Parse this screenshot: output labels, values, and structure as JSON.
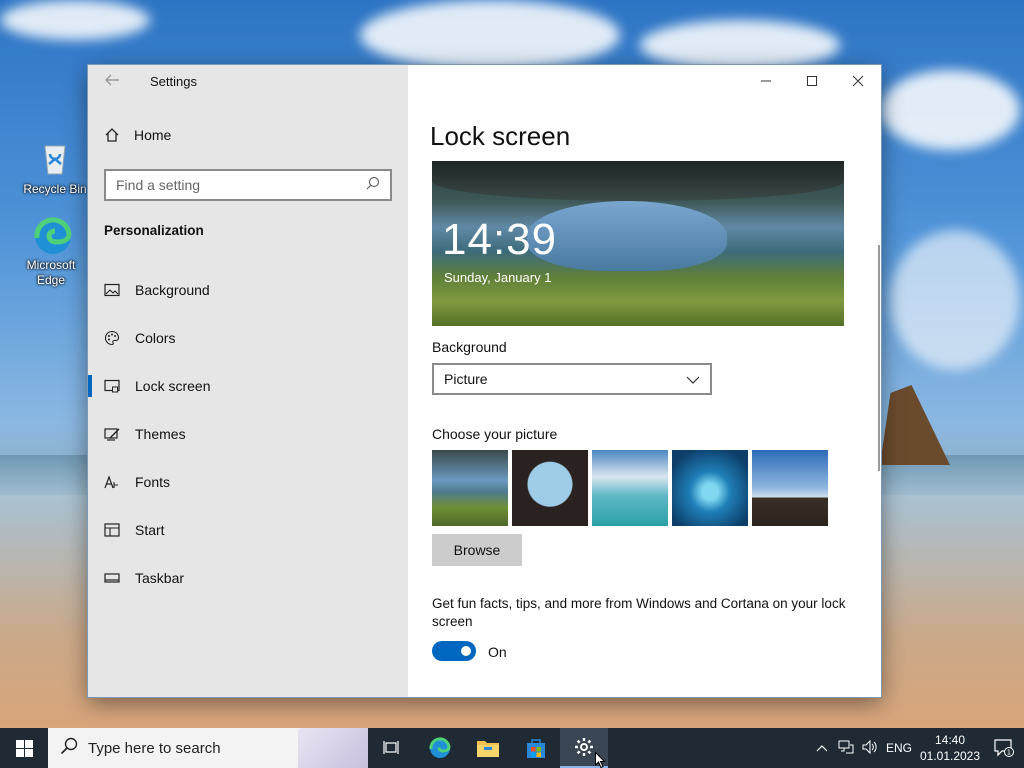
{
  "desktop": {
    "icons": [
      {
        "label": "Recycle Bin"
      },
      {
        "label": "Microsoft Edge"
      }
    ]
  },
  "window": {
    "title": "Settings",
    "controls": {
      "minimize": "—",
      "maximize": "☐",
      "close": "✕"
    }
  },
  "sidebar": {
    "home_label": "Home",
    "search_placeholder": "Find a setting",
    "section": "Personalization",
    "items": [
      {
        "label": "Background",
        "icon": "image-icon"
      },
      {
        "label": "Colors",
        "icon": "palette-icon"
      },
      {
        "label": "Lock screen",
        "icon": "lock-screen-icon",
        "active": true
      },
      {
        "label": "Themes",
        "icon": "themes-icon"
      },
      {
        "label": "Fonts",
        "icon": "fonts-icon"
      },
      {
        "label": "Start",
        "icon": "start-icon"
      },
      {
        "label": "Taskbar",
        "icon": "taskbar-icon"
      }
    ]
  },
  "content": {
    "title": "Lock screen",
    "preview": {
      "time": "14:39",
      "date": "Sunday, January 1"
    },
    "background_label": "Background",
    "background_value": "Picture",
    "choose_label": "Choose your picture",
    "browse_label": "Browse",
    "fun_facts_text": "Get fun facts, tips, and more from Windows and Cortana on your lock screen",
    "toggle_state": "On"
  },
  "taskbar": {
    "search_placeholder": "Type here to search",
    "language": "ENG",
    "time": "14:40",
    "date": "01.01.2023",
    "notification_count": "1"
  },
  "colors": {
    "accent": "#0067c0",
    "sidebar_bg": "#e6e6e6",
    "taskbar_bg": "#1f2a35"
  }
}
